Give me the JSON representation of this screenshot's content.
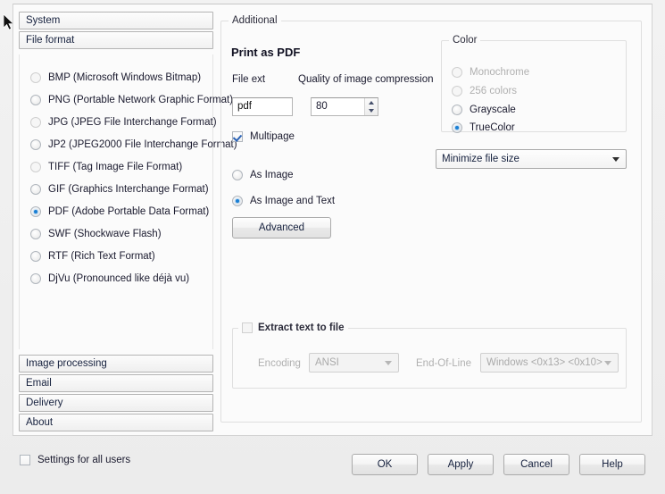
{
  "sidebar": {
    "tabs_top": [
      {
        "label": "System"
      },
      {
        "label": "File format"
      }
    ],
    "formats": [
      {
        "label": "BMP (Microsoft Windows Bitmap)",
        "selected": false
      },
      {
        "label": "PNG (Portable Network Graphic Format)",
        "selected": false
      },
      {
        "label": "JPG (JPEG File Interchange Format)",
        "selected": false
      },
      {
        "label": "JP2 (JPEG2000 File Interchange Format)",
        "selected": false
      },
      {
        "label": "TIFF (Tag Image File Format)",
        "selected": false
      },
      {
        "label": "GIF (Graphics Interchange Format)",
        "selected": false
      },
      {
        "label": "PDF (Adobe Portable Data Format)",
        "selected": true
      },
      {
        "label": "SWF (Shockwave Flash)",
        "selected": false
      },
      {
        "label": "RTF (Rich Text Format)",
        "selected": false
      },
      {
        "label": "DjVu (Pronounced like déjà vu)",
        "selected": false
      }
    ],
    "tabs_bottom": [
      {
        "label": "Image processing"
      },
      {
        "label": "Email"
      },
      {
        "label": "Delivery"
      },
      {
        "label": "About"
      }
    ]
  },
  "main": {
    "group_title": "Additional",
    "heading": "Print as PDF",
    "file_ext": {
      "label": "File ext",
      "value": "pdf"
    },
    "quality": {
      "label": "Quality of image compression",
      "value": "80"
    },
    "multipage": {
      "label": "Multipage",
      "checked": true
    },
    "render_modes": [
      {
        "label": "As Image",
        "selected": false
      },
      {
        "label": "As Image and Text",
        "selected": true
      }
    ],
    "advanced_button": "Advanced",
    "color_group": {
      "title": "Color",
      "options": [
        {
          "label": "Monochrome",
          "selected": false,
          "disabled": true
        },
        {
          "label": "256 colors",
          "selected": false,
          "disabled": true
        },
        {
          "label": "Grayscale",
          "selected": false,
          "disabled": false
        },
        {
          "label": "TrueColor",
          "selected": true,
          "disabled": false
        }
      ]
    },
    "size_mode": {
      "value": "Minimize file size"
    },
    "extract": {
      "title": "Extract text to file",
      "checked": false,
      "encoding_label": "Encoding",
      "encoding_value": "ANSI",
      "eol_label": "End-Of-Line",
      "eol_value": "Windows <0x13> <0x10>"
    }
  },
  "footer": {
    "settings_all_users": {
      "label": "Settings for all users",
      "checked": false
    },
    "buttons": [
      {
        "label": "OK"
      },
      {
        "label": "Apply"
      },
      {
        "label": "Cancel"
      },
      {
        "label": "Help"
      }
    ]
  },
  "colors": {
    "accent": "#1a7fd4",
    "panel_bg": "#fbfbfb",
    "window_bg": "#f0f0f0",
    "border": "#d3d3d3"
  }
}
